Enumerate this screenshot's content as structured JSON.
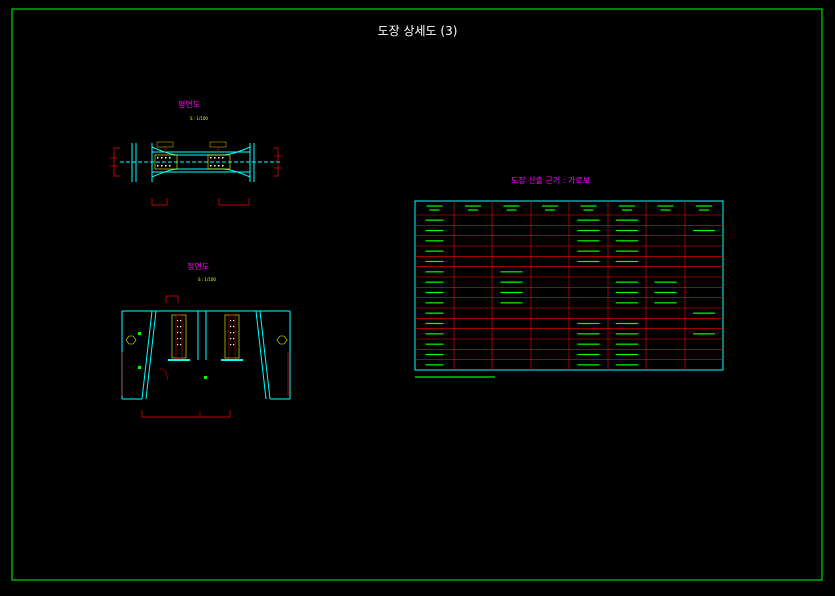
{
  "drawing": {
    "title": "도장 상세도 (3)",
    "plan_title": "평면도",
    "plan_scale": "S : 1/100",
    "front_title": "정면도",
    "front_scale": "S : 1/100",
    "table_title": "도장 산출 근거 : 가로보"
  },
  "colors": {
    "background": "#000000",
    "frame": "#00ff00",
    "member": "#00ffff",
    "dimension": "#ff0000",
    "table_text": "#00ff00",
    "title_text": "#ffffff",
    "view_title": "#ff00ff"
  }
}
